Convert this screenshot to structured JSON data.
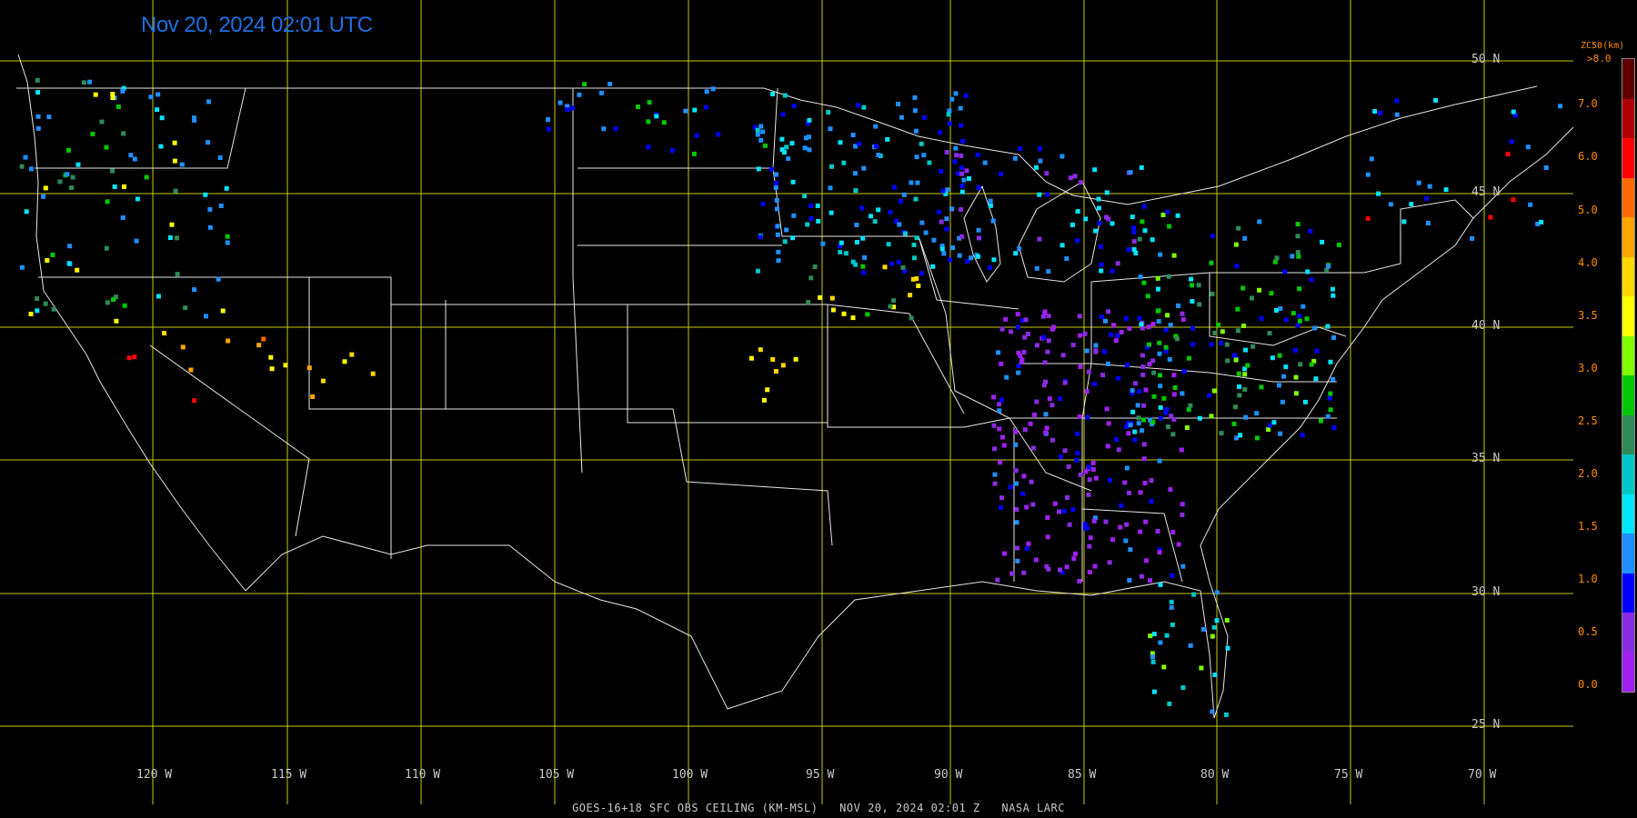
{
  "title": "Nov 20, 2024 02:01 UTC",
  "footer": {
    "product": "GOES-16+18  SFC OBS CEILING (KM-MSL)",
    "datetime": "NOV 20, 2024 02:01 Z",
    "credit": "NASA LARC"
  },
  "latitude_labels": [
    "50 N",
    "45 N",
    "40 N",
    "35 N",
    "30 N",
    "25 N"
  ],
  "longitude_labels": [
    "120 W",
    "115 W",
    "110 W",
    "105 W",
    "100 W",
    "95 W",
    "90 W",
    "85 W",
    "80 W",
    "75 W",
    "70 W"
  ],
  "legend": {
    "title": "ZC50(km)",
    "top_label": ">8.0",
    "labels": [
      "7.0",
      "6.0",
      "5.0",
      "4.0",
      "3.5",
      "3.0",
      "2.5",
      "2.0",
      "1.5",
      "1.0",
      "0.5",
      "0.0"
    ],
    "colors": [
      "#a020f0",
      "#8a2be2",
      "#0000ff",
      "#1e90ff",
      "#00e5ff",
      "#00c8c8",
      "#2e8b57",
      "#00c800",
      "#7fff00",
      "#ffff00",
      "#ffd700",
      "#ffa500",
      "#ff6a00",
      "#ff0000",
      "#b00000",
      "#600000"
    ]
  },
  "colors": {
    "grid": "#c8c800",
    "border": "#e6e6e6",
    "title": "#1e6fe0",
    "legend_text": "#ff8c00"
  }
}
